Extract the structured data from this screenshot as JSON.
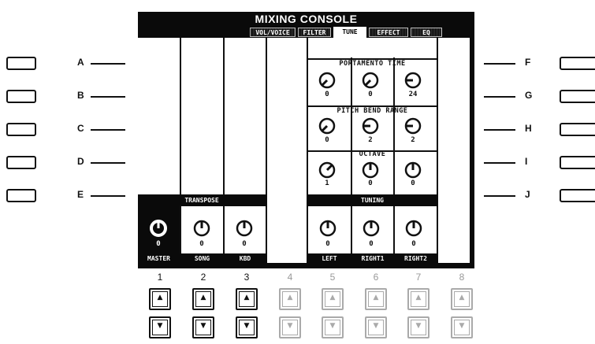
{
  "screen": {
    "title": "MIXING CONSOLE",
    "tabs": [
      {
        "label": "VOL/VOICE",
        "state": "dim"
      },
      {
        "label": "FILTER",
        "state": "dim"
      },
      {
        "label": "TUNE",
        "state": "active"
      },
      {
        "label": "EFFECT",
        "state": "dim"
      },
      {
        "label": "EQ",
        "state": "dim"
      }
    ],
    "portamento": {
      "label": "PORTAMENTO TIME",
      "values": [
        "0",
        "0",
        "24"
      ]
    },
    "pitch_bend": {
      "label": "PITCH BEND RANGE",
      "values": [
        "0",
        "2",
        "2"
      ]
    },
    "octave": {
      "label": "OCTAVE",
      "values": [
        "1",
        "0",
        "0"
      ]
    },
    "transpose": {
      "label": "TRANSPOSE",
      "values": [
        "0",
        "0",
        "0"
      ]
    },
    "tuning": {
      "label": "TUNING",
      "values": [
        "0",
        "0",
        "0"
      ]
    },
    "bottom_labels": [
      "MASTER",
      "SONG",
      "KBD",
      "",
      "LEFT",
      "RIGHT1",
      "RIGHT2"
    ]
  },
  "left_buttons": [
    "A",
    "B",
    "C",
    "D",
    "E"
  ],
  "right_buttons": [
    "F",
    "G",
    "H",
    "I",
    "J"
  ],
  "column_numbers": [
    "1",
    "2",
    "3",
    "4",
    "5",
    "6",
    "7",
    "8"
  ],
  "arrows": {
    "up": "▲",
    "down": "▼"
  }
}
